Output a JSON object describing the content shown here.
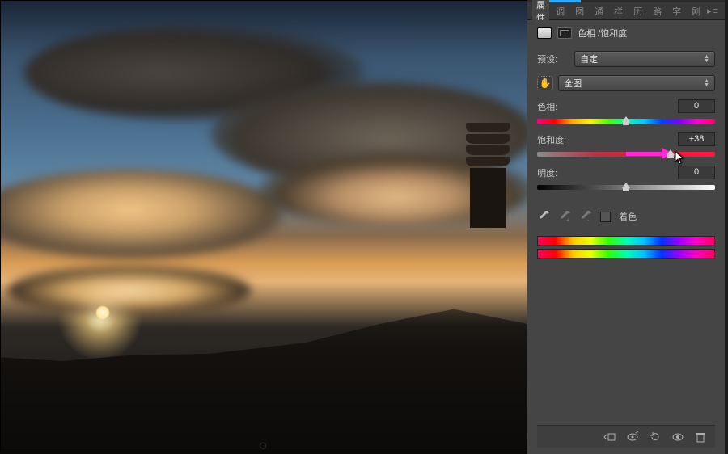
{
  "tabs": {
    "items": [
      "属性",
      "调",
      "图",
      "通",
      "样",
      "历",
      "路",
      "字",
      "剧"
    ],
    "active_index": 0
  },
  "adjustment": {
    "title": "色相 /饱和度",
    "preset_label": "预设:",
    "preset_value": "自定",
    "scope_value": "全图",
    "sliders": {
      "hue": {
        "label": "色相:",
        "value": "0",
        "pos_pct": 50
      },
      "saturation": {
        "label": "饱和度:",
        "value": "+38",
        "pos_pct": 75,
        "arrow_from_pct": 50
      },
      "lightness": {
        "label": "明度:",
        "value": "0",
        "pos_pct": 50
      }
    },
    "colorize_label": "着色",
    "colorize_checked": false
  },
  "icons": {
    "hand": "hand-scrubber-icon",
    "eye": "eyedropper-icon",
    "eye_plus": "eyedropper-plus-icon",
    "eye_minus": "eyedropper-minus-icon",
    "clip": "clip-to-layer-icon",
    "prev": "view-previous-icon",
    "reset": "reset-icon",
    "vis": "visibility-icon",
    "trash": "trash-icon",
    "menu": "panel-menu-icon"
  },
  "watermark": "⬡"
}
